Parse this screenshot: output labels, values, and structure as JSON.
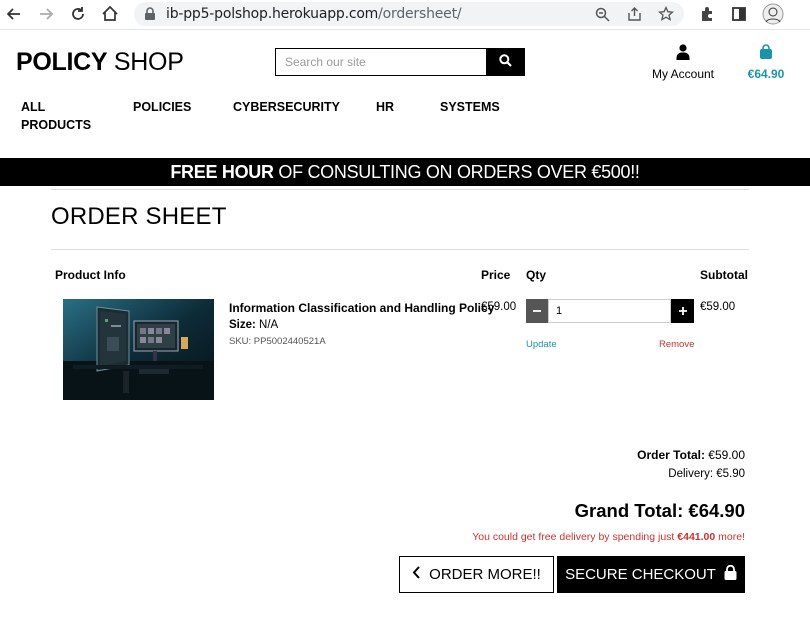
{
  "browser": {
    "url_host": "ib-pp5-polshop.herokuapp.com",
    "url_path": "/ordersheet/"
  },
  "site": {
    "logo_bold": "POLICY",
    "logo_light": " SHOP",
    "search_placeholder": "Search our site",
    "account_label": "My Account",
    "bag_total": "€64.90",
    "accent_color": "#1b93a8",
    "warning_color": "#d0312d"
  },
  "nav": {
    "all_line1": "ALL",
    "all_line2": "PRODUCTS",
    "policies": "POLICIES",
    "cybersecurity": "CYBERSECURITY",
    "hr": "HR",
    "systems": "SYSTEMS"
  },
  "banner": {
    "bold": "FREE HOUR",
    "rest": " OF CONSULTING ON ORDERS OVER €500!!"
  },
  "page": {
    "title": "ORDER SHEET"
  },
  "table": {
    "headers": {
      "product_info": "Product Info",
      "price": "Price",
      "qty": "Qty",
      "subtotal": "Subtotal"
    },
    "rows": [
      {
        "name": "Information Classification and Handling Policy",
        "size_label": "Size:",
        "size_value": " N/A",
        "sku": "SKU: PP5002440521A",
        "price": "€59.00",
        "qty": "1",
        "update": "Update",
        "remove": "Remove",
        "subtotal": "€59.00"
      }
    ]
  },
  "totals": {
    "order_total_label": "Order Total:",
    "order_total_value": " €59.00",
    "delivery": "Delivery: €5.90",
    "grand_total": "Grand Total: €64.90",
    "free_delivery_prefix": "You could get free delivery by spending just ",
    "free_delivery_amount": "€441.00",
    "free_delivery_suffix": " more!"
  },
  "buttons": {
    "order_more": "ORDER MORE!!",
    "secure_checkout": "SECURE CHECKOUT"
  }
}
